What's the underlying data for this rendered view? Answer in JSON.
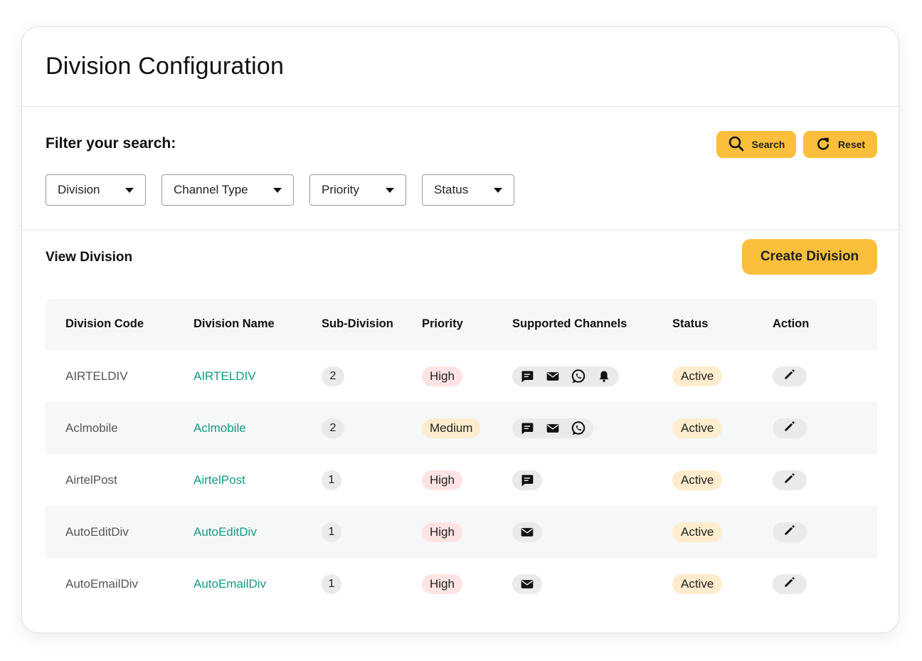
{
  "page": {
    "title": "Division Configuration"
  },
  "filter": {
    "title": "Filter your search:",
    "search_label": "Search",
    "reset_label": "Reset",
    "dropdowns": [
      {
        "label": "Division"
      },
      {
        "label": "Channel Type"
      },
      {
        "label": "Priority"
      },
      {
        "label": "Status"
      }
    ]
  },
  "view": {
    "title": "View Division",
    "create_label": "Create Division"
  },
  "table": {
    "headers": [
      "Division Code",
      "Division Name",
      "Sub-Division",
      "Priority",
      "Supported Channels",
      "Status",
      "Action"
    ],
    "rows": [
      {
        "code": "AIRTELDIV",
        "name": "AIRTELDIV",
        "sub": "2",
        "priority": "High",
        "channels": [
          "sms-icon",
          "email-icon",
          "whatsapp-icon",
          "notification-bell-icon"
        ],
        "status": "Active"
      },
      {
        "code": "Aclmobile",
        "name": "Aclmobile",
        "sub": "2",
        "priority": "Medium",
        "channels": [
          "sms-icon",
          "email-icon",
          "whatsapp-icon"
        ],
        "status": "Active"
      },
      {
        "code": "AirtelPost",
        "name": "AirtelPost",
        "sub": "1",
        "priority": "High",
        "channels": [
          "sms-icon"
        ],
        "status": "Active"
      },
      {
        "code": "AutoEditDiv",
        "name": "AutoEditDiv",
        "sub": "1",
        "priority": "High",
        "channels": [
          "email-icon"
        ],
        "status": "Active"
      },
      {
        "code": "AutoEmailDiv",
        "name": "AutoEmailDiv",
        "sub": "1",
        "priority": "High",
        "channels": [
          "email-icon"
        ],
        "status": "Active"
      }
    ]
  },
  "colors": {
    "accent": "#fbbf3c",
    "link": "#129a85",
    "high_bg": "#fde3e3",
    "medium_bg": "#fdeccd",
    "status_bg": "#fdeccd"
  }
}
